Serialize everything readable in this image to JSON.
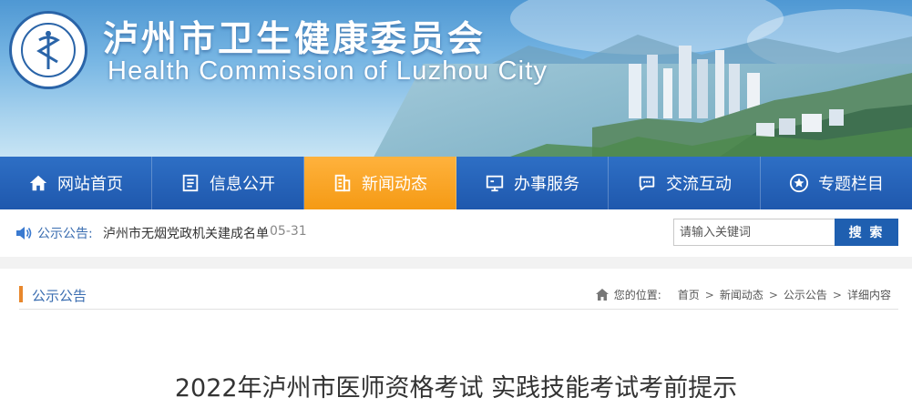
{
  "header": {
    "title_cn": "泸州市卫生健康委员会",
    "title_en": "Health Commission of Luzhou City",
    "logo_text": "Health Commission of Luzhou City"
  },
  "nav": {
    "items": [
      {
        "label": "网站首页",
        "icon": "home-icon"
      },
      {
        "label": "信息公开",
        "icon": "document-icon"
      },
      {
        "label": "新闻动态",
        "icon": "building-icon",
        "active": true
      },
      {
        "label": "办事服务",
        "icon": "monitor-icon"
      },
      {
        "label": "交流互动",
        "icon": "chat-icon"
      },
      {
        "label": "专题栏目",
        "icon": "star-icon"
      }
    ],
    "active_color": "#f59a14",
    "bar_color": "#1f58ad"
  },
  "notice": {
    "label": "公示公告:",
    "item": "泸州市无烟党政机关建成名单",
    "date": "05-31"
  },
  "search": {
    "placeholder": "请输入关键词",
    "button_label": "搜 索"
  },
  "section": {
    "title": "公示公告"
  },
  "breadcrumb": {
    "prefix": "您的位置:",
    "items": [
      "首页",
      "新闻动态",
      "公示公告",
      "详细内容"
    ],
    "separator": ">"
  },
  "article": {
    "title": "2022年泸州市医师资格考试 实践技能考试考前提示"
  }
}
